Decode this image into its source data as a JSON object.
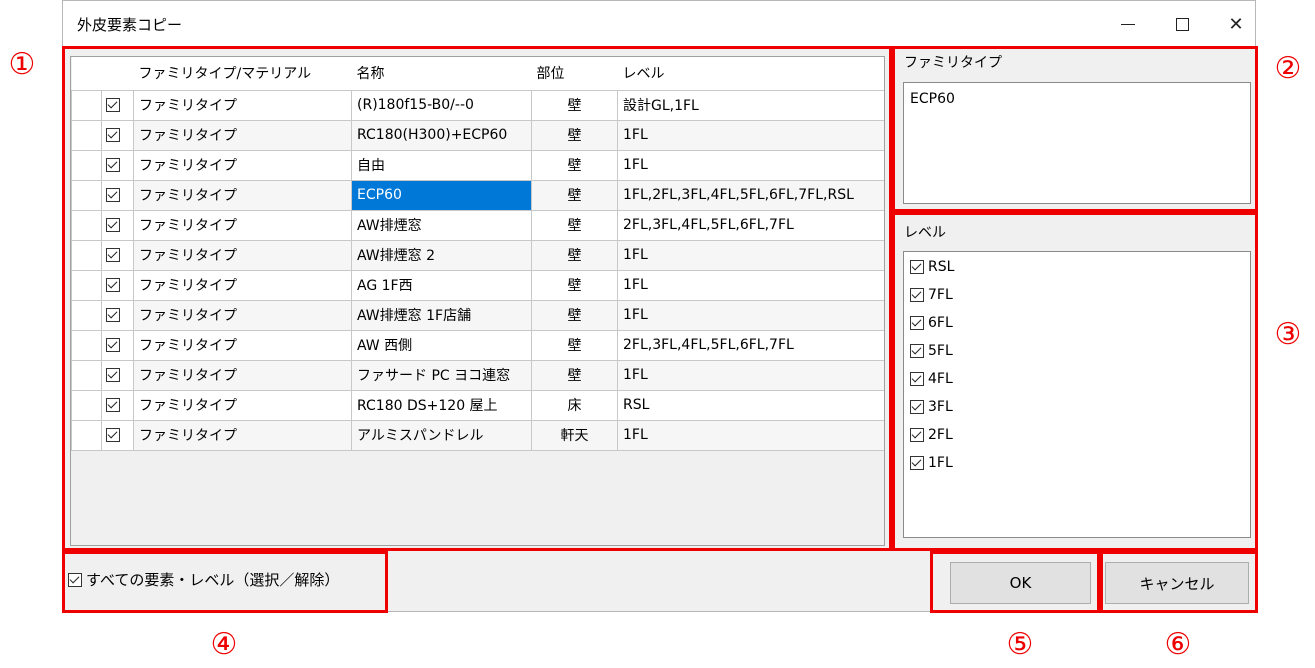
{
  "window": {
    "title": "外皮要素コピー"
  },
  "grid": {
    "columns": [
      "ファミリタイプ/マテリアル",
      "名称",
      "部位",
      "レベル"
    ],
    "rows": [
      {
        "type": "ファミリタイプ",
        "name": "(R)180f15-B0/--0",
        "part": "壁",
        "level": "設計GL,1FL"
      },
      {
        "type": "ファミリタイプ",
        "name": "RC180(H300)+ECP60",
        "part": "壁",
        "level": "1FL"
      },
      {
        "type": "ファミリタイプ",
        "name": "自由",
        "part": "壁",
        "level": "1FL"
      },
      {
        "type": "ファミリタイプ",
        "name": "ECP60",
        "part": "壁",
        "level": "1FL,2FL,3FL,4FL,5FL,6FL,7FL,RSL"
      },
      {
        "type": "ファミリタイプ",
        "name": "AW排煙窓",
        "part": "壁",
        "level": "2FL,3FL,4FL,5FL,6FL,7FL"
      },
      {
        "type": "ファミリタイプ",
        "name": "AW排煙窓 2",
        "part": "壁",
        "level": "1FL"
      },
      {
        "type": "ファミリタイプ",
        "name": "AG 1F西",
        "part": "壁",
        "level": "1FL"
      },
      {
        "type": "ファミリタイプ",
        "name": "AW排煙窓 1F店舗",
        "part": "壁",
        "level": "1FL"
      },
      {
        "type": "ファミリタイプ",
        "name": "AW 西側",
        "part": "壁",
        "level": "2FL,3FL,4FL,5FL,6FL,7FL"
      },
      {
        "type": "ファミリタイプ",
        "name": "ファサード PC ヨコ連窓",
        "part": "壁",
        "level": "1FL"
      },
      {
        "type": "ファミリタイプ",
        "name": "RC180 DS+120 屋上",
        "part": "床",
        "level": "RSL"
      },
      {
        "type": "ファミリタイプ",
        "name": "アルミスパンドレル",
        "part": "軒天",
        "level": "1FL"
      }
    ]
  },
  "family_panel": {
    "label": "ファミリタイプ",
    "value": "ECP60"
  },
  "level_panel": {
    "label": "レベル",
    "items": [
      "RSL",
      "7FL",
      "6FL",
      "5FL",
      "4FL",
      "3FL",
      "2FL",
      "1FL"
    ]
  },
  "bottom": {
    "select_all_label": "すべての要素・レベル（選択／解除）",
    "ok_label": "OK",
    "cancel_label": "キャンセル"
  },
  "annotations": [
    "①",
    "②",
    "③",
    "④",
    "⑤",
    "⑥"
  ],
  "colors": {
    "annotation": "#ee0000",
    "selection": "#0078d7"
  }
}
